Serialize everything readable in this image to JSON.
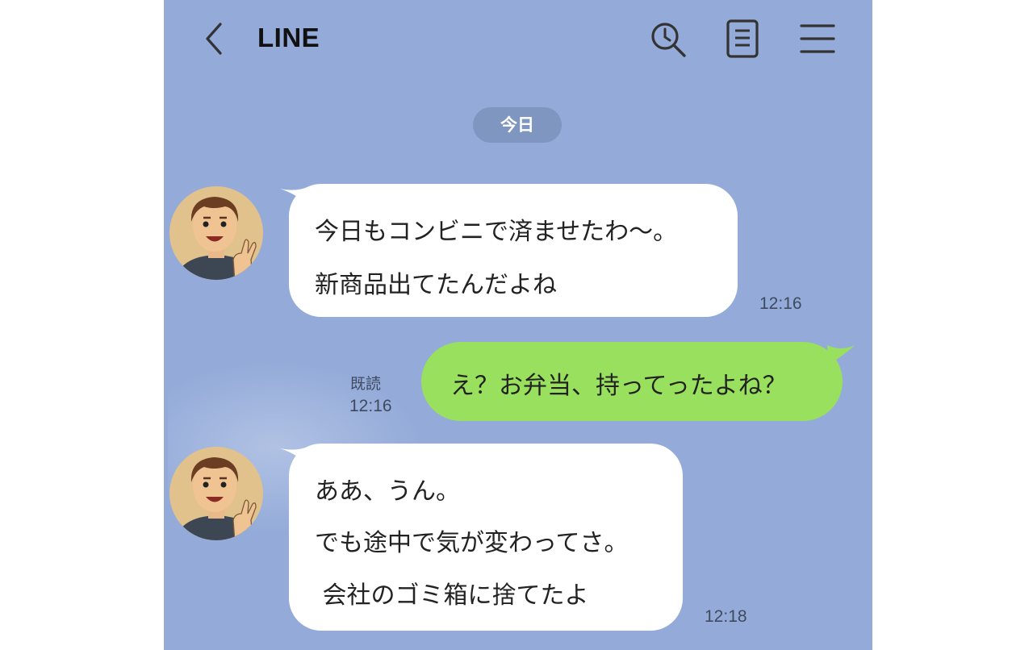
{
  "header": {
    "title": "LINE",
    "icons": [
      "back-icon",
      "search-icon",
      "notes-icon",
      "menu-icon"
    ]
  },
  "date_label": "今日",
  "messages": [
    {
      "sender": "friend",
      "lines": [
        "今日もコンビニで済ませたわ〜。",
        "新商品出てたんだよね"
      ],
      "time": "12:16"
    },
    {
      "sender": "me",
      "lines": [
        "え？お弁当、持ってったよね？"
      ],
      "read_label": "既読",
      "time": "12:16"
    },
    {
      "sender": "friend",
      "lines": [
        "ああ、うん。",
        "でも途中で気が変わってさ。",
        " 会社のゴミ箱に捨てたよ"
      ],
      "time": "12:18"
    }
  ],
  "colors": {
    "background": "#94abd9",
    "sent_bubble": "#99e05e",
    "received_bubble": "#ffffff",
    "date_pill": "#7f96c0"
  }
}
